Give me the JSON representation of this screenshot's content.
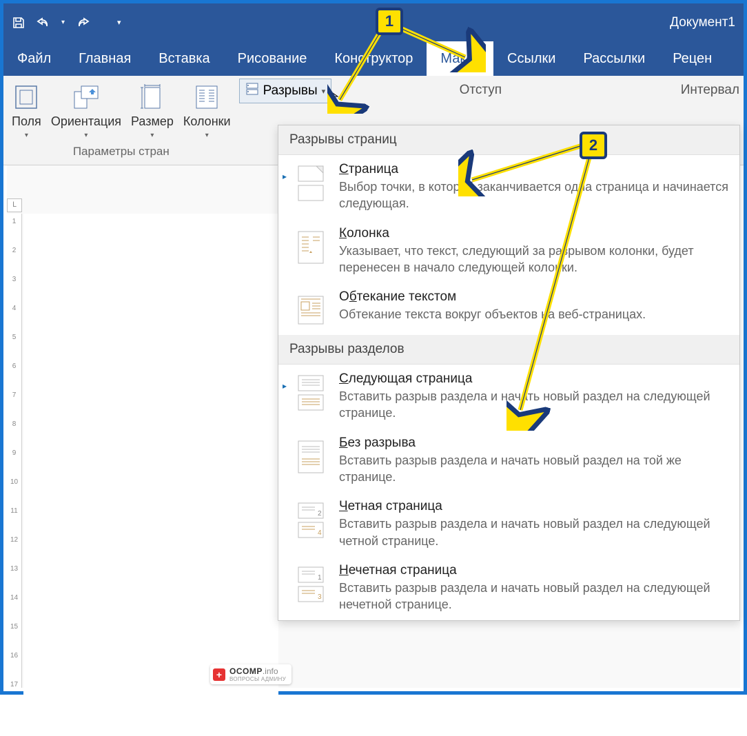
{
  "titlebar": {
    "document_title": "Документ1"
  },
  "tabs": {
    "file": "Файл",
    "home": "Главная",
    "insert": "Вставка",
    "draw": "Рисование",
    "design": "Конструктор",
    "layout": "Макет",
    "references": "Ссылки",
    "mailings": "Рассылки",
    "review": "Рецен"
  },
  "ribbon": {
    "margins": "Поля",
    "orientation": "Ориентация",
    "size": "Размер",
    "columns": "Колонки",
    "group_page_setup": "Параметры стран",
    "breaks": "Разрывы",
    "indent": "Отступ",
    "spacing": "Интервал"
  },
  "dropdown": {
    "section1": "Разрывы страниц",
    "section2": "Разрывы разделов",
    "items": [
      {
        "title_pre": "",
        "title_u": "С",
        "title_post": "траница",
        "desc": "Выбор точки, в которой заканчивается одна страница и начинается следующая."
      },
      {
        "title_pre": "",
        "title_u": "К",
        "title_post": "олонка",
        "desc": "Указывает, что текст, следующий за разрывом колонки, будет перенесен в начало следующей колонки."
      },
      {
        "title_pre": "О",
        "title_u": "б",
        "title_post": "текание текстом",
        "desc": "Обтекание текста вокруг объектов на веб-страницах."
      },
      {
        "title_pre": "",
        "title_u": "С",
        "title_post": "ледующая страница",
        "desc": "Вставить разрыв раздела и начать новый раздел на следующей странице."
      },
      {
        "title_pre": "",
        "title_u": "Б",
        "title_post": "ез разрыва",
        "desc": "Вставить разрыв раздела и начать новый раздел на той же странице."
      },
      {
        "title_pre": "",
        "title_u": "Ч",
        "title_post": "етная страница",
        "desc": "Вставить разрыв раздела и начать новый раздел на следующей четной странице."
      },
      {
        "title_pre": "",
        "title_u": "Н",
        "title_post": "ечетная страница",
        "desc": "Вставить разрыв раздела и начать новый раздел на следующей нечетной странице."
      }
    ]
  },
  "callouts": {
    "one": "1",
    "two": "2"
  },
  "ruler_corner": "L",
  "watermark": {
    "brand": "OCOMP",
    "suffix": ".info",
    "sub": "ВОПРОСЫ АДМИНУ"
  }
}
